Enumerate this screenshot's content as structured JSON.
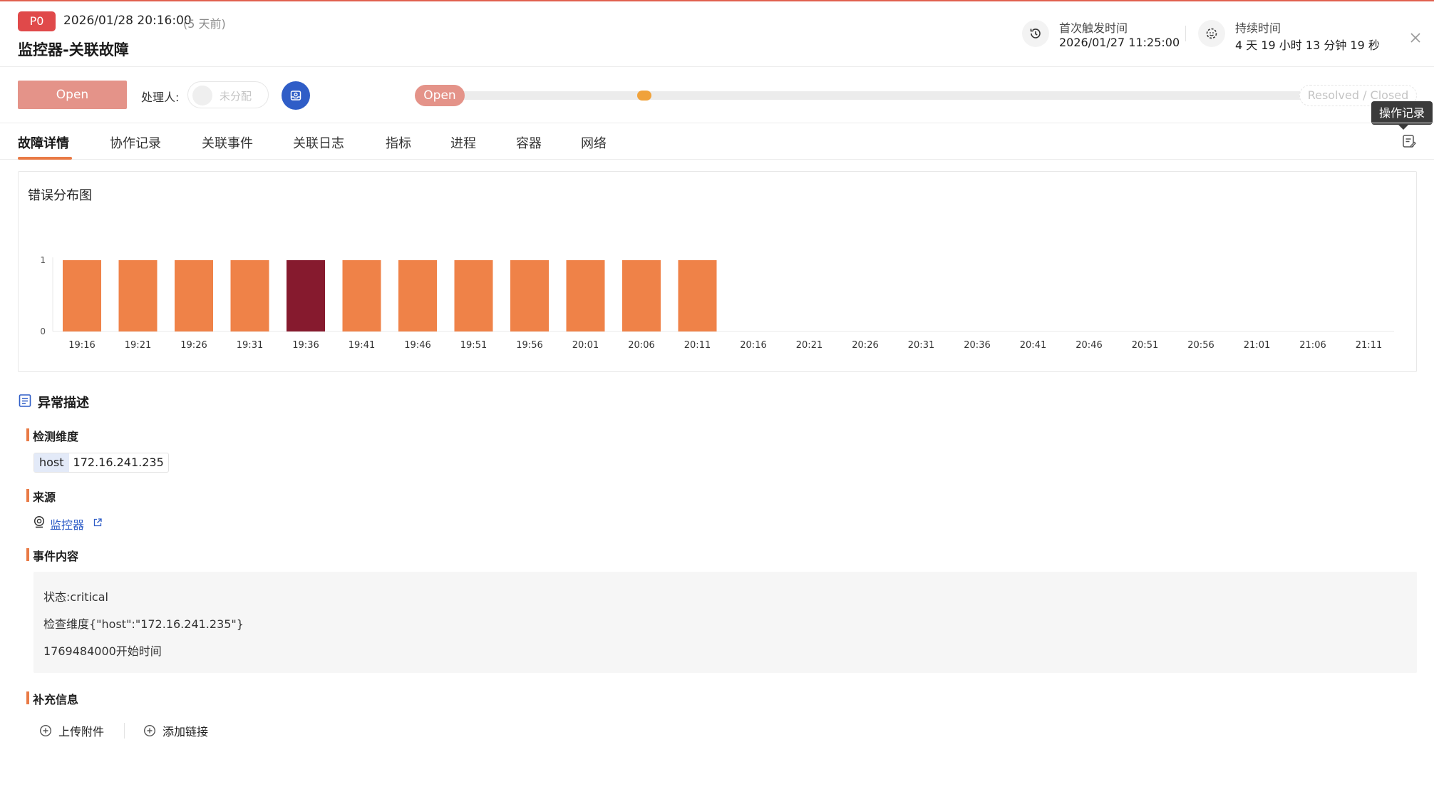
{
  "header": {
    "priority": "P0",
    "time": "2026/01/28 20:16:00",
    "ago": "(5 天前)",
    "title": "监控器-关联故障",
    "first_trigger_label": "首次触发时间",
    "first_trigger_value": "2026/01/27 11:25:00",
    "duration_label": "持续时间",
    "duration_value": "4 天 19 小时 13 分钟 19 秒"
  },
  "status_row": {
    "status_button": "Open",
    "assignee_label": "处理人:",
    "assignee_value": "未分配",
    "progress_start": "Open",
    "progress_end": "Resolved / Closed",
    "tooltip": "操作记录"
  },
  "tabs": [
    "故障详情",
    "协作记录",
    "关联事件",
    "关联日志",
    "指标",
    "进程",
    "容器",
    "网络"
  ],
  "chart_data": {
    "type": "bar",
    "title": "错误分布图",
    "categories": [
      "19:16",
      "19:21",
      "19:26",
      "19:31",
      "19:36",
      "19:41",
      "19:46",
      "19:51",
      "19:56",
      "20:01",
      "20:06",
      "20:11",
      "20:16",
      "20:21",
      "20:26",
      "20:31",
      "20:36",
      "20:41",
      "20:46",
      "20:51",
      "20:56",
      "21:01",
      "21:06",
      "21:11"
    ],
    "values": [
      1,
      1,
      1,
      1,
      1,
      1,
      1,
      1,
      1,
      1,
      1,
      1,
      0,
      0,
      0,
      0,
      0,
      0,
      0,
      0,
      0,
      0,
      0,
      0
    ],
    "highlight_index": 4,
    "ylim": [
      0,
      1
    ],
    "yticks": [
      "0",
      "1"
    ],
    "colors": {
      "bar": "#ef8248",
      "highlight": "#861a2e",
      "axis": "#e8e8e8"
    }
  },
  "description": {
    "section_title": "异常描述",
    "dimension_title": "检测维度",
    "dimension_key": "host",
    "dimension_value": "172.16.241.235",
    "source_title": "来源",
    "source_link": "监控器",
    "event_title": "事件内容",
    "event_lines": [
      "状态:critical",
      "检查维度{\"host\":\"172.16.241.235\"}",
      "1769484000开始时间"
    ],
    "extra_title": "补充信息",
    "upload_label": "上传附件",
    "add_link_label": "添加链接"
  },
  "icons": {
    "first_trigger": "clock-history-icon",
    "duration": "timer-icon",
    "close": "close-icon",
    "assign": "inbox-user-icon",
    "oplog": "edit-log-icon",
    "section": "document-icon",
    "source": "monitor-icon",
    "external": "external-link-icon",
    "plus": "plus-circle-icon"
  }
}
